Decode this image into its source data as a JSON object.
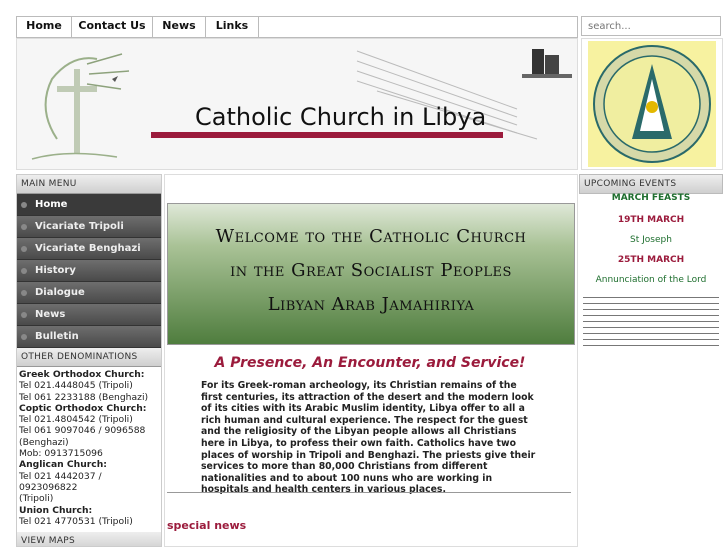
{
  "nav": [
    "Home",
    "Contact Us",
    "News",
    "Links"
  ],
  "search": {
    "placeholder": "search..."
  },
  "banner": {
    "title": "Catholic Church in Libya"
  },
  "left": {
    "main_menu_label": "MAIN MENU",
    "menu": [
      "Home",
      "Vicariate Tripoli",
      "Vicariate Benghazi",
      "History",
      "Dialogue",
      "News",
      "Bulletin"
    ],
    "other_label": "OTHER DENOMINATIONS",
    "denominations": [
      {
        "name": "Greek Orthodox Church:",
        "lines": [
          "Tel 021.4448045 (Tripoli)",
          "Tel 061 2233188 (Benghazi)"
        ]
      },
      {
        "name": "Coptic Orthodox Church:",
        "lines": [
          "Tel 021.4804542 (Tripoli)",
          "Tel 061 9097046 / 9096588",
          "(Benghazi)",
          "Mob: 0913715096"
        ]
      },
      {
        "name": "Anglican Church:",
        "lines": [
          "Tel 021 4442037 / 0923096822",
          "(Tripoli)"
        ]
      },
      {
        "name": "Union Church:",
        "lines": [
          "Tel 021 4770531 (Tripoli)"
        ]
      }
    ],
    "maps_label": "VIEW MAPS"
  },
  "center": {
    "welcome_lines": [
      "Welcome to the Catholic Church",
      "in the Great Socialist Peoples",
      "Libyan Arab Jamahiriya"
    ],
    "tagline": "A Presence, An Encounter, and Service!",
    "body": "For its Greek-roman archeology, its Christian remains of the first centuries, its attraction of the desert and the modern look of its cities with its Arabic Muslim identity, Libya offer to all a rich human and cultural experience. The respect for the guest and the religiosity of the Libyan people allows all Christians here in Libya, to profess their own faith. Catholics have two places of worship in Tripoli and Benghazi. The priests give their services to more than 80,000 Christians from different nationalities and to about 100 nuns who are working in hospitals and health centers in various places.",
    "special_news": "special news"
  },
  "right": {
    "events_label": "UPCOMING EVENTS",
    "heading": "MARCH FEASTS",
    "events": [
      {
        "date": "19TH MARCH",
        "title": "St Joseph"
      },
      {
        "date": "25TH MARCH",
        "title": "Annunciation of the Lord"
      }
    ]
  },
  "colors": {
    "accent": "#9b1b3c",
    "event_green": "#1e6e2e",
    "menu_bg": "#4a4a4a"
  }
}
